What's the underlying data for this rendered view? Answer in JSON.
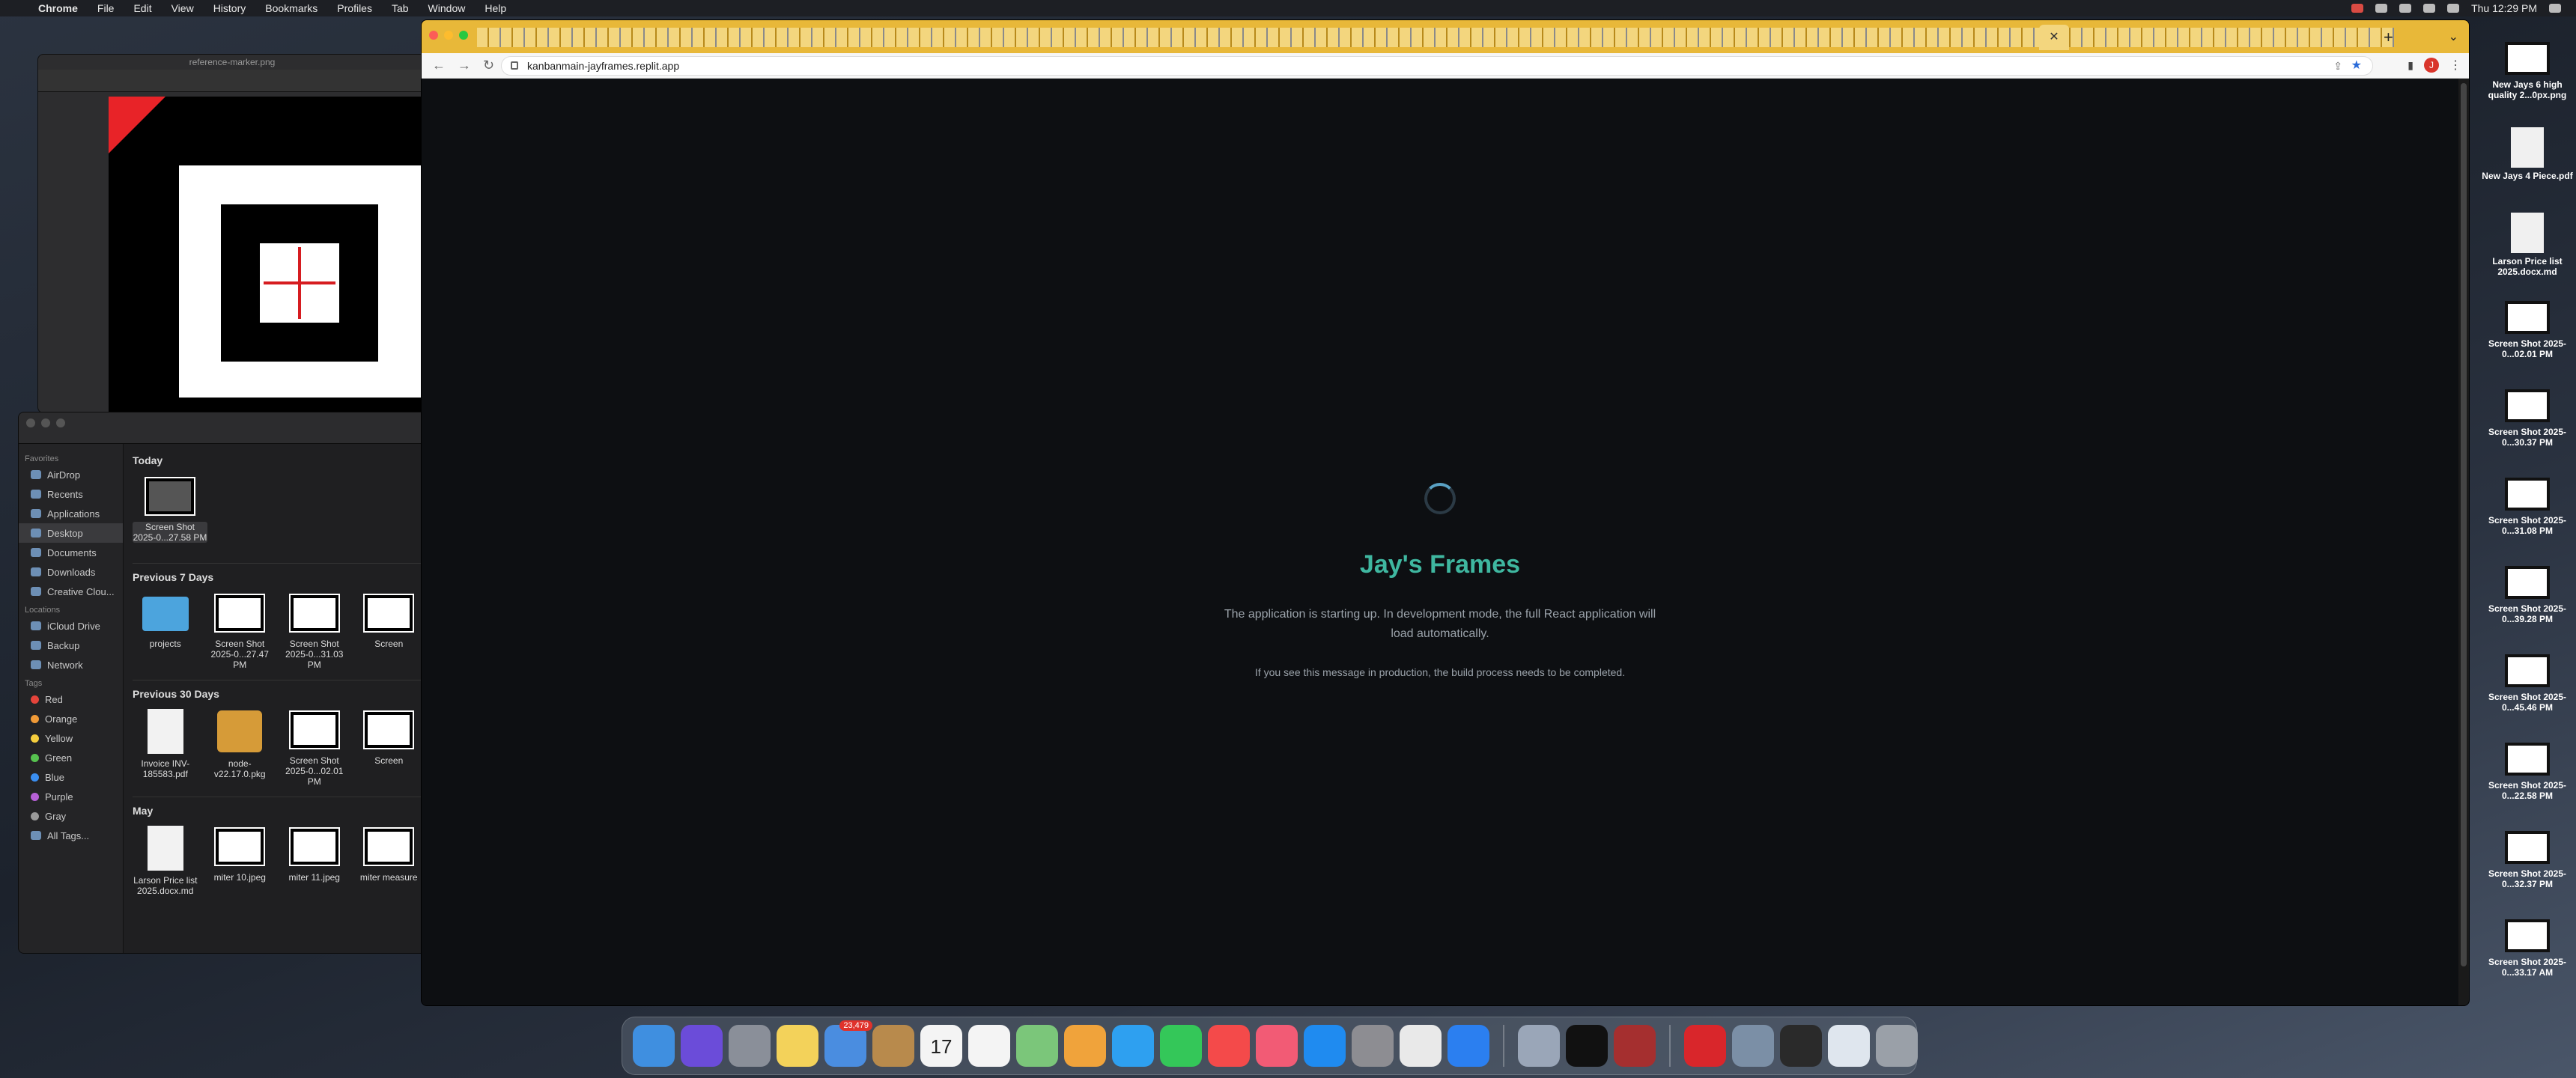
{
  "menubar": {
    "app": "Chrome",
    "items": [
      "File",
      "Edit",
      "View",
      "History",
      "Bookmarks",
      "Profiles",
      "Tab",
      "Window",
      "Help"
    ],
    "clock": "Thu 12:29 PM"
  },
  "preview": {
    "title": "reference-marker.png"
  },
  "finder": {
    "sidebar": {
      "favorites_header": "Favorites",
      "favorites": [
        "AirDrop",
        "Recents",
        "Applications",
        "Desktop",
        "Documents",
        "Downloads",
        "Creative Clou..."
      ],
      "locations_header": "Locations",
      "locations": [
        "iCloud Drive",
        "Backup",
        "Network"
      ],
      "tags_header": "Tags",
      "tags": [
        {
          "name": "Red",
          "color": "#e5443b"
        },
        {
          "name": "Orange",
          "color": "#f09a37"
        },
        {
          "name": "Yellow",
          "color": "#f5cd3d"
        },
        {
          "name": "Green",
          "color": "#56c24f"
        },
        {
          "name": "Blue",
          "color": "#3a8ef0"
        },
        {
          "name": "Purple",
          "color": "#b660d6"
        },
        {
          "name": "Gray",
          "color": "#9a9a9a"
        }
      ],
      "all_tags": "All Tags..."
    },
    "sections": {
      "today": "Today",
      "prev7": "Previous 7 Days",
      "prev30": "Previous 30 Days",
      "may": "May"
    },
    "today_items": [
      "Screen Shot 2025-0...27.58 PM"
    ],
    "prev7_items": [
      "projects",
      "Screen Shot 2025-0...27.47 PM",
      "Screen Shot 2025-0...31.03 PM",
      "Screen"
    ],
    "prev30_items": [
      "Invoice INV-185583.pdf",
      "node-v22.17.0.pkg",
      "Screen Shot 2025-0...02.01 PM",
      "Screen"
    ],
    "may_items": [
      "Larson Price list 2025.docx.md",
      "miter 10.jpeg",
      "miter 11.jpeg",
      "miter measure"
    ]
  },
  "browser": {
    "url": "kanbanmain-jayframes.replit.app",
    "avatar_initial": "J",
    "page": {
      "title": "Jay's Frames",
      "message": "The application is starting up. In development mode, the full React application will load automatically.",
      "note": "If you see this message in production, the build process needs to be completed."
    }
  },
  "desktop_icons": [
    "New Jays 6 high quality 2...0px.png",
    "New Jays 4 Piece.pdf",
    "Larson Price list 2025.docx.md",
    "Screen Shot 2025-0...02.01 PM",
    "Screen Shot 2025-0...30.37 PM",
    "Screen Shot 2025-0...31.08 PM",
    "Screen Shot 2025-0...39.28 PM",
    "Screen Shot 2025-0...45.46 PM",
    "Screen Shot 2025-0...22.58 PM",
    "Screen Shot 2025-0...32.37 PM",
    "Screen Shot 2025-0...33.17 AM"
  ],
  "dock": {
    "mail_badge": "23,479",
    "calendar_day": "17",
    "apps": [
      {
        "name": "finder-icon",
        "color": "#3f8fe0"
      },
      {
        "name": "siri-icon",
        "color": "#6b4cd9"
      },
      {
        "name": "launchpad-icon",
        "color": "#8a8f99"
      },
      {
        "name": "notes-icon",
        "color": "#f3d25a"
      },
      {
        "name": "mail-icon",
        "color": "#4a8de0"
      },
      {
        "name": "contacts-icon",
        "color": "#b88a4c"
      },
      {
        "name": "calendar-icon",
        "color": "#f4f4f4"
      },
      {
        "name": "reminders-icon",
        "color": "#f4f4f4"
      },
      {
        "name": "maps-icon",
        "color": "#7bc67a"
      },
      {
        "name": "photos-icon",
        "color": "#f0a33b"
      },
      {
        "name": "messages-icon",
        "color": "#2ea0f0"
      },
      {
        "name": "facetime-icon",
        "color": "#34c759"
      },
      {
        "name": "news-icon",
        "color": "#f44a4a"
      },
      {
        "name": "music-icon",
        "color": "#f25b75"
      },
      {
        "name": "appstore-icon",
        "color": "#1f8bf0"
      },
      {
        "name": "settings-icon",
        "color": "#8d8d92"
      },
      {
        "name": "chrome-icon",
        "color": "#e9e9e9"
      },
      {
        "name": "safari-icon",
        "color": "#2b7ff0"
      },
      {
        "name": "preview-icon",
        "color": "#9aa6b8"
      },
      {
        "name": "terminal-icon",
        "color": "#111111"
      },
      {
        "name": "dictionary-icon",
        "color": "#a52f2f"
      },
      {
        "name": "creative-cloud-icon",
        "color": "#d9262b"
      },
      {
        "name": "stack-icon",
        "color": "#7b8fa6"
      },
      {
        "name": "stack2-icon",
        "color": "#2a2a2a"
      },
      {
        "name": "stack3-icon",
        "color": "#dfe6ee"
      },
      {
        "name": "trash-icon",
        "color": "#9aa0a8"
      }
    ]
  }
}
